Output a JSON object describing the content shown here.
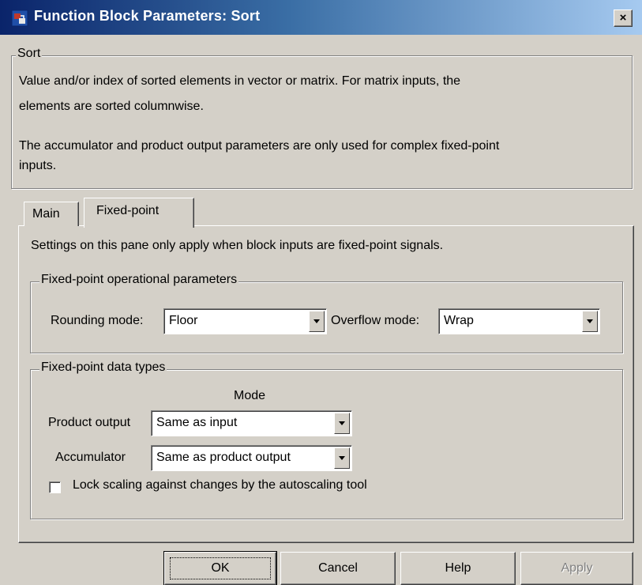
{
  "window": {
    "title": "Function Block Parameters: Sort",
    "close_label": "×",
    "app_icon": "simulink-block-icon"
  },
  "block": {
    "group_label": "Sort",
    "description_1": "Value and/or index of sorted elements in vector or matrix.  For matrix inputs, the",
    "description_2": "elements are sorted columnwise.",
    "description_3": "The accumulator and product output parameters are only used for complex fixed-point",
    "description_4": "inputs."
  },
  "tabs": [
    {
      "label": "Main",
      "selected": false
    },
    {
      "label": "Fixed-point",
      "selected": true
    }
  ],
  "pane": {
    "note": "Settings on this pane only apply when block inputs are fixed-point signals."
  },
  "operational": {
    "group_label": "Fixed-point operational parameters",
    "rounding_label": "Rounding mode:",
    "rounding_value": "Floor",
    "overflow_label": "Overflow mode:",
    "overflow_value": "Wrap"
  },
  "datatypes": {
    "group_label": "Fixed-point data types",
    "mode_header": "Mode",
    "product_label": "Product output",
    "product_value": "Same as input",
    "accumulator_label": "Accumulator",
    "accumulator_value": "Same as product output",
    "lock_label": "Lock scaling against changes by the autoscaling tool",
    "lock_checked": false
  },
  "buttons": {
    "ok": "OK",
    "cancel": "Cancel",
    "help": "Help",
    "apply": "Apply"
  },
  "colors": {
    "dialog_face": "#d4d0c8",
    "title_gradient_start": "#0a246a",
    "title_gradient_end": "#a6caf0"
  }
}
